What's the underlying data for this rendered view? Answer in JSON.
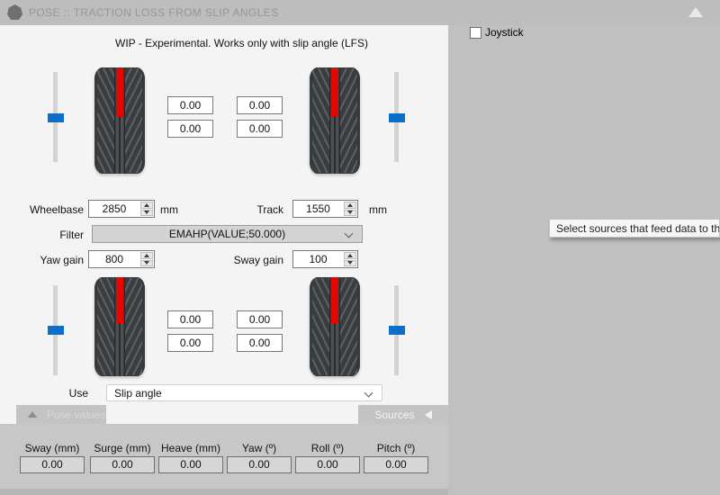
{
  "header": {
    "title": "POSE :: TRACTION LOSS FROM SLIP ANGLES"
  },
  "panel": {
    "wip_note": "WIP - Experimental. Works only with slip angle (LFS)",
    "front": {
      "values": [
        "0.00",
        "0.00",
        "0.00",
        "0.00"
      ]
    },
    "rear": {
      "values": [
        "0.00",
        "0.00",
        "0.00",
        "0.00"
      ]
    },
    "wheelbase": {
      "label": "Wheelbase",
      "value": "2850",
      "unit": "mm"
    },
    "track": {
      "label": "Track",
      "value": "1550",
      "unit": "mm"
    },
    "filter": {
      "label": "Filter",
      "value": "EMAHP(VALUE;50.000)"
    },
    "yaw_gain": {
      "label": "Yaw gain",
      "value": "800"
    },
    "sway_gain": {
      "label": "Sway gain",
      "value": "100"
    },
    "use": {
      "label": "Use",
      "value": "Slip angle"
    }
  },
  "tabs": {
    "pose_values": "Pose values",
    "sources": "Sources"
  },
  "pose": {
    "fields": [
      {
        "label": "Sway (mm)",
        "value": "0.00"
      },
      {
        "label": "Surge (mm)",
        "value": "0.00"
      },
      {
        "label": "Heave (mm)",
        "value": "0.00"
      },
      {
        "label": "Yaw (º)",
        "value": "0.00"
      },
      {
        "label": "Roll (º)",
        "value": "0.00"
      },
      {
        "label": "Pitch (º)",
        "value": "0.00"
      }
    ]
  },
  "right": {
    "joystick_label": "Joystick",
    "tooltip": "Select sources that feed data to th"
  },
  "colors": {
    "accent_blue": "#0d6fc8",
    "indicator_red": "#e20800",
    "titlebar_bg": "#bdbdbd",
    "panel_bg": "#f4f4f4",
    "right_bg": "#c0c0c0"
  }
}
